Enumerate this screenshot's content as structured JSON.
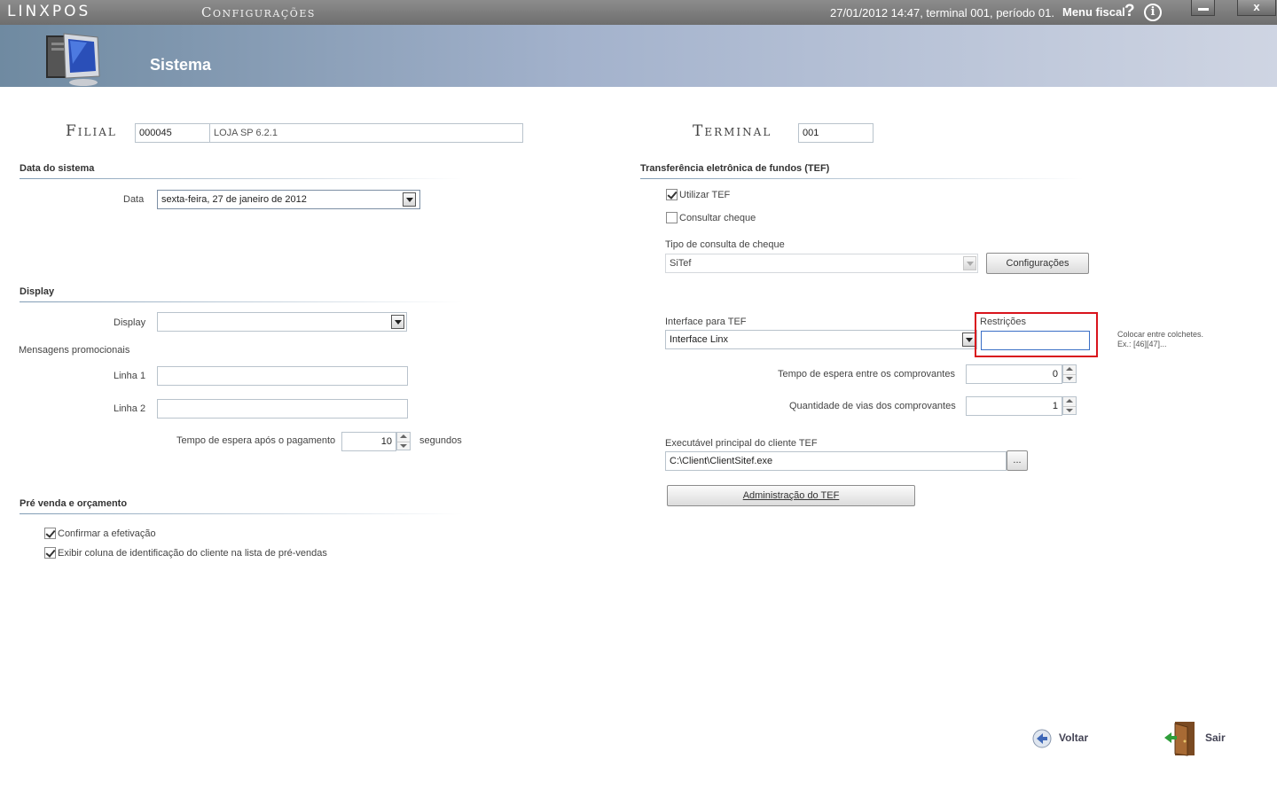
{
  "titlebar": {
    "app_logo": "LINXPOS",
    "screen_name": "Configurações",
    "status": "27/01/2012 14:47, terminal 001, período 01.",
    "menu_fiscal": "Menu fiscal",
    "help_glyph": "?",
    "info_glyph": "i",
    "close_glyph": "x",
    "icons": [
      "help-icon",
      "info-icon",
      "minimize-icon",
      "close-icon"
    ]
  },
  "header": {
    "title": "Sistema",
    "icon": "computer-icon"
  },
  "filial": {
    "label": "Filial",
    "code": "000045",
    "name": "LOJA SP 6.2.1"
  },
  "terminal": {
    "label": "Terminal",
    "value": "001"
  },
  "data_section": {
    "title": "Data do sistema",
    "data_label": "Data",
    "data_value": "sexta-feira, 27 de janeiro de 2012"
  },
  "display_section": {
    "title": "Display",
    "display_label": "Display",
    "display_value": "",
    "mensagens_label": "Mensagens promocionais",
    "linha1_label": "Linha 1",
    "linha1_value": "",
    "linha2_label": "Linha 2",
    "linha2_value": "",
    "tempo_label": "Tempo de espera após o pagamento",
    "tempo_value": "10",
    "tempo_unit": "segundos"
  },
  "prevenda_section": {
    "title": "Pré venda e orçamento",
    "confirmar_label": "Confirmar a efetivação",
    "confirmar_checked": true,
    "exibir_label": "Exibir coluna de identificação do cliente na lista de pré-vendas",
    "exibir_checked": true
  },
  "tef_section": {
    "title": "Transferência eletrônica de fundos (TEF)",
    "utilizar_label": "Utilizar TEF",
    "utilizar_checked": true,
    "consultar_label": "Consultar cheque",
    "consultar_checked": false,
    "tipo_label": "Tipo de consulta de cheque",
    "tipo_value": "SiTef",
    "configuracoes_button": "Configurações",
    "interface_label": "Interface para TEF",
    "interface_value": "Interface Linx",
    "restricoes_label": "Restrições",
    "restricoes_value": "",
    "hint_line1": "Colocar entre colchetes.",
    "hint_line2": "Ex.: [46][47]...",
    "highlight_color": "#d9141c",
    "tempo_label": "Tempo de espera entre os comprovantes",
    "tempo_value": "0",
    "vias_label": "Quantidade de vias dos comprovantes",
    "vias_value": "1",
    "executavel_label": "Executável principal do cliente TEF",
    "executavel_value": "C:\\Client\\ClientSitef.exe",
    "browse_button": "...",
    "admin_button": "Administração do TEF"
  },
  "footer": {
    "voltar": "Voltar",
    "sair": "Sair"
  }
}
